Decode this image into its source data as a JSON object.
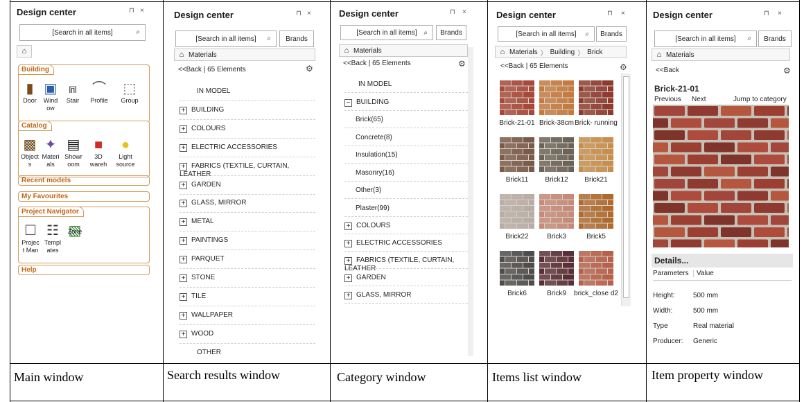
{
  "app_title": "Design center",
  "pin_glyph": "⊓",
  "close_glyph": "×",
  "search_placeholder": "[Search in all items]",
  "brands_label": "Brands",
  "captions": [
    "Main window",
    "Search results window",
    "Category window",
    "Items list window",
    "Item property window"
  ],
  "main": {
    "sections": {
      "building": {
        "title": "Building",
        "items": [
          "Door",
          "Wind ow",
          "Stair",
          "Profile",
          "Group"
        ]
      },
      "catalog": {
        "title": "Catalog",
        "items": [
          "Object s",
          "Materi als",
          "Showr oom",
          "3D wareh",
          "Light source"
        ]
      },
      "recent": "Recent models",
      "favourites": "My Favourites",
      "navigator": {
        "title": "Project Navigator",
        "items": [
          "Projec t Man",
          "Templ ates",
          "Zone"
        ]
      },
      "help": "Help"
    }
  },
  "search_results": {
    "crumb": "Materials",
    "back": "<<Back",
    "count": "| 65 Elements",
    "rows": [
      "IN MODEL",
      "BUILDING",
      "COLOURS",
      "ELECTRIC ACCESSORIES",
      "FABRICS (TEXTILE, CURTAIN, LEATHER",
      "GARDEN",
      "GLASS, MIRROR",
      "METAL",
      "PAINTINGS",
      "PARQUET",
      "STONE",
      "TILE",
      "WALLPAPER",
      "WOOD",
      "OTHER"
    ]
  },
  "category": {
    "crumb": "Materials",
    "back": "<<Back",
    "count": "| 65 Elements",
    "top": "IN MODEL",
    "building": "BUILDING",
    "sub": [
      "Brick(65)",
      "Concrete(8)",
      "Insulation(15)",
      "Masonry(16)",
      "Other(3)",
      "Plaster(99)"
    ],
    "rest": [
      "COLOURS",
      "ELECTRIC ACCESSORIES",
      "FABRICS (TEXTILE, CURTAIN, LEATHER",
      "GARDEN",
      "GLASS, MIRROR"
    ]
  },
  "items": {
    "crumbs": [
      "Materials",
      "Building",
      "Brick"
    ],
    "back": "<<Back",
    "count": "| 65 Elements",
    "tiles": [
      {
        "label": "Brick-21-01",
        "color": "#a8483a"
      },
      {
        "label": "Brick-38cm",
        "color": "#c77a3e"
      },
      {
        "label": "Brick- running",
        "color": "#8e3a30"
      },
      {
        "label": "Brick11",
        "color": "#7a5a48"
      },
      {
        "label": "Brick12",
        "color": "#6b6258"
      },
      {
        "label": "Brick21",
        "color": "#c98e4c"
      },
      {
        "label": "Brick22",
        "color": "#b9aea6"
      },
      {
        "label": "Brick3",
        "color": "#c88a78"
      },
      {
        "label": "Brick5",
        "color": "#b06a2e"
      },
      {
        "label": "Brick6",
        "color": "#4e4c4c"
      },
      {
        "label": "Brick9",
        "color": "#5a2e36"
      },
      {
        "label": "brick_close d2",
        "color": "#b8604c"
      }
    ]
  },
  "property": {
    "crumb": "Materials",
    "back": "<<Back",
    "name": "Brick-21-01",
    "prev": "Previous",
    "next": "Next",
    "jump": "Jump to category",
    "details": "Details...",
    "param_header": "Parameters",
    "value_header": "Value",
    "params": [
      {
        "k": "Height:",
        "v": "500 mm"
      },
      {
        "k": "Width:",
        "v": "500 mm"
      },
      {
        "k": "Type",
        "v": "Real material"
      },
      {
        "k": "Producer:",
        "v": "Generic"
      }
    ]
  },
  "colors": {
    "accent": "#c06818",
    "border": "#d19a5a",
    "brick": "#9c3f33"
  }
}
